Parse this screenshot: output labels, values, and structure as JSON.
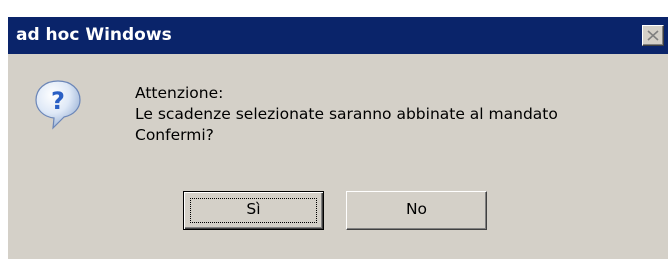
{
  "window": {
    "title": "ad hoc Windows",
    "close_icon": "close-icon"
  },
  "icon": {
    "name": "question-icon",
    "glyph": "?"
  },
  "message": {
    "line1": "Attenzione:",
    "line2": "Le scadenze selezionate saranno abbinate al mandato",
    "line3": "Confermi?"
  },
  "buttons": {
    "yes_label": "Sì",
    "no_label": "No"
  },
  "colors": {
    "titlebar": "#0a246a",
    "dialog_background": "#d4d0c8",
    "icon_blue": "#2a5fc4"
  }
}
